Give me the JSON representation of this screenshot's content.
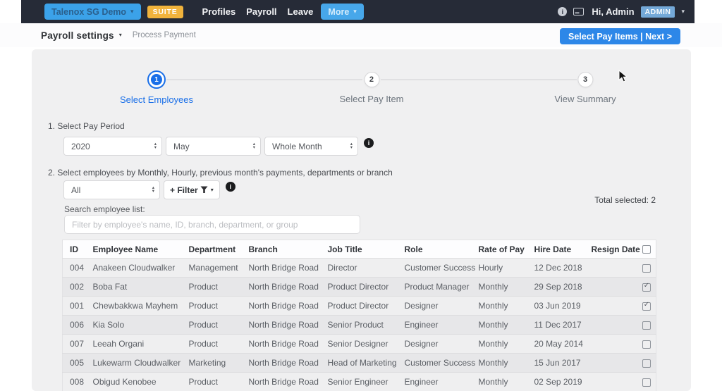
{
  "navbar": {
    "company_selector": "Talenox SG Demo",
    "suite_badge": "SUITE",
    "links": [
      "Profiles",
      "Payroll",
      "Leave"
    ],
    "more_label": "More",
    "greeting": "Hi, Admin",
    "admin_badge": "ADMIN"
  },
  "breadcrumb": {
    "title": "Payroll settings",
    "subtitle": "Process Payment",
    "action_button": "Select Pay Items | Next >"
  },
  "stepper": {
    "steps": [
      {
        "number": "1",
        "label": "Select Employees",
        "active": true
      },
      {
        "number": "2",
        "label": "Select Pay Item",
        "active": false
      },
      {
        "number": "3",
        "label": "View Summary",
        "active": false
      }
    ]
  },
  "pay_period": {
    "label": "1. Select Pay Period",
    "year": "2020",
    "month": "May",
    "range": "Whole Month"
  },
  "employee_selection": {
    "label": "2. Select employees by Monthly, Hourly, previous month's payments, departments or branch",
    "type_filter": "All",
    "filter_button": "+ Filter",
    "search_label": "Search employee list:",
    "search_placeholder": "Filter by employee's name, ID, branch, department, or group",
    "total_selected": "Total selected: 2"
  },
  "table": {
    "headers": [
      "ID",
      "Employee Name",
      "Department",
      "Branch",
      "Job Title",
      "Role",
      "Rate of Pay",
      "Hire Date",
      "Resign Date"
    ],
    "rows": [
      {
        "cells": [
          "004",
          "Anakeen Cloudwalker",
          "Management",
          "North Bridge Road",
          "Director",
          "Customer Success",
          "Hourly",
          "12 Dec 2018",
          ""
        ],
        "checked": false
      },
      {
        "cells": [
          "002",
          "Boba Fat",
          "Product",
          "North Bridge Road",
          "Product Director",
          "Product Manager",
          "Monthly",
          "29 Sep 2018",
          ""
        ],
        "checked": true
      },
      {
        "cells": [
          "001",
          "Chewbakkwa Mayhem",
          "Product",
          "North Bridge Road",
          "Product Director",
          "Designer",
          "Monthly",
          "03 Jun 2019",
          ""
        ],
        "checked": true
      },
      {
        "cells": [
          "006",
          "Kia Solo",
          "Product",
          "North Bridge Road",
          "Senior Product",
          "Engineer",
          "Monthly",
          "11 Dec 2017",
          ""
        ],
        "checked": false
      },
      {
        "cells": [
          "007",
          "Leeah Organi",
          "Product",
          "North Bridge Road",
          "Senior Designer",
          "Designer",
          "Monthly",
          "20 May 2014",
          ""
        ],
        "checked": false
      },
      {
        "cells": [
          "005",
          "Lukewarm Cloudwalker",
          "Marketing",
          "North Bridge Road",
          "Head of Marketing",
          "Customer Success",
          "Monthly",
          "15 Jun 2017",
          ""
        ],
        "checked": false
      },
      {
        "cells": [
          "008",
          "Obigud Kenobee",
          "Product",
          "North Bridge Road",
          "Senior Engineer",
          "Engineer",
          "Monthly",
          "02 Sep 2019",
          ""
        ],
        "checked": false
      }
    ]
  },
  "colors": {
    "navbar_bg": "#262b37",
    "accent_blue": "#3ba2e9",
    "action_blue": "#2d87e8",
    "step_blue": "#1a6fe8",
    "suite_orange": "#f1b33c",
    "admin_badge_blue": "#74a9d8",
    "panel_gray": "#f0f0f1"
  }
}
